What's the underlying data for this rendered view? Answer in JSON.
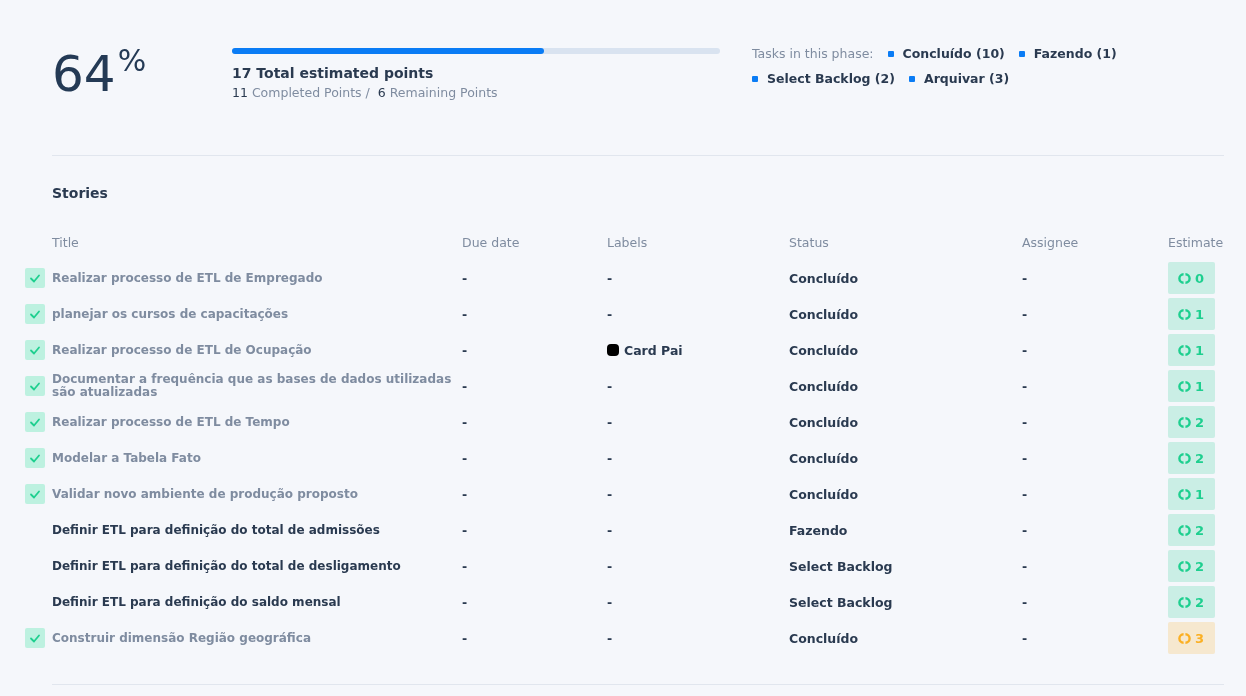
{
  "summary": {
    "percent": "64",
    "percent_sign": "%",
    "level": 0.64,
    "total": "17 Total estimated points",
    "completed_count": "11",
    "completed_label": "Completed Points /",
    "remaining_count": "6",
    "remaining_label": "Remaining Points"
  },
  "phase": {
    "label": "Tasks in this phase:",
    "items": [
      {
        "text": "Concluído (10)",
        "color": "#0a7cf5"
      },
      {
        "text": "Fazendo (1)",
        "color": "#0a7cf5"
      },
      {
        "text": "Select Backlog (2)",
        "color": "#0a7cf5"
      },
      {
        "text": "Arquivar (3)",
        "color": "#0a7cf5"
      }
    ]
  },
  "stories": {
    "title": "Stories",
    "columns": [
      "Title",
      "Due date",
      "Labels",
      "Status",
      "Assignee",
      "Estimate"
    ],
    "rows": [
      {
        "checked": true,
        "title": "Realizar processo de ETL de Empregado",
        "due": "-",
        "label": {
          "text": "-"
        },
        "status": "Concluído",
        "assignee": "-",
        "estimate": {
          "value": "0",
          "color": "#1ecf8f"
        }
      },
      {
        "checked": true,
        "title": "planejar os cursos de capacitações",
        "due": "-",
        "label": {
          "text": "-"
        },
        "status": "Concluído",
        "assignee": "-",
        "estimate": {
          "value": "1",
          "color": "#1ecf8f"
        }
      },
      {
        "checked": true,
        "title": "Realizar processo de ETL de Ocupação",
        "due": "-",
        "label": {
          "text": "Card Pai",
          "color": "#000000"
        },
        "status": "Concluído",
        "assignee": "-",
        "estimate": {
          "value": "1",
          "color": "#1ecf8f"
        }
      },
      {
        "checked": true,
        "title": "Documentar a frequência que as bases de dados utilizadas são atualizadas",
        "due": "-",
        "label": {
          "text": "-"
        },
        "status": "Concluído",
        "assignee": "-",
        "estimate": {
          "value": "1",
          "color": "#1ecf8f"
        }
      },
      {
        "checked": true,
        "title": "Realizar processo de ETL de Tempo",
        "due": "-",
        "label": {
          "text": "-"
        },
        "status": "Concluído",
        "assignee": "-",
        "estimate": {
          "value": "2",
          "color": "#1ecf8f"
        }
      },
      {
        "checked": true,
        "title": "Modelar a Tabela Fato",
        "due": "-",
        "label": {
          "text": "-"
        },
        "status": "Concluído",
        "assignee": "-",
        "estimate": {
          "value": "2",
          "color": "#1ecf8f"
        }
      },
      {
        "checked": true,
        "title": "Validar novo ambiente de produção proposto",
        "due": "-",
        "label": {
          "text": "-"
        },
        "status": "Concluído",
        "assignee": "-",
        "estimate": {
          "value": "1",
          "color": "#1ecf8f"
        }
      },
      {
        "checked": false,
        "title": "Definir ETL para definição do total de admissões",
        "due": "-",
        "label": {
          "text": "-"
        },
        "status": "Fazendo",
        "assignee": "-",
        "estimate": {
          "value": "2",
          "color": "#1ecf8f"
        }
      },
      {
        "checked": false,
        "title": "Definir ETL para definição do total de desligamento",
        "due": "-",
        "label": {
          "text": "-"
        },
        "status": "Select Backlog",
        "assignee": "-",
        "estimate": {
          "value": "2",
          "color": "#1ecf8f"
        }
      },
      {
        "checked": false,
        "title": "Definir ETL para definição do saldo mensal",
        "due": "-",
        "label": {
          "text": "-"
        },
        "status": "Select Backlog",
        "assignee": "-",
        "estimate": {
          "value": "2",
          "color": "#1ecf8f"
        }
      },
      {
        "checked": true,
        "title": "Construir dimensão Região geográfica",
        "due": "-",
        "label": {
          "text": "-"
        },
        "status": "Concluído",
        "assignee": "-",
        "estimate": {
          "value": "3",
          "color": "#fbb024"
        }
      }
    ]
  }
}
